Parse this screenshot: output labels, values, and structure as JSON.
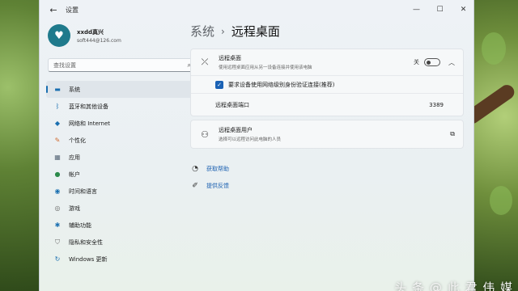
{
  "window": {
    "app_title": "设置",
    "back_icon": "←",
    "controls": [
      "—",
      "☐",
      "✕"
    ]
  },
  "profile": {
    "name": "xxdd真兴",
    "email": "soft444@126.com"
  },
  "search": {
    "placeholder": "查找设置"
  },
  "sidebar": {
    "items": [
      {
        "label": "系统",
        "icon": "display-icon",
        "color": "#1a6fb0",
        "active": true
      },
      {
        "label": "蓝牙和其他设备",
        "icon": "bluetooth-icon",
        "color": "#1a6fb0"
      },
      {
        "label": "网络和 Internet",
        "icon": "wifi-icon",
        "color": "#1a6fb0"
      },
      {
        "label": "个性化",
        "icon": "brush-icon",
        "color": "#d06a2f"
      },
      {
        "label": "应用",
        "icon": "apps-icon",
        "color": "#5a6a7a"
      },
      {
        "label": "帐户",
        "icon": "person-icon",
        "color": "#2b8a4a"
      },
      {
        "label": "时间和语言",
        "icon": "globe-icon",
        "color": "#1a6fb0"
      },
      {
        "label": "游戏",
        "icon": "gamepad-icon",
        "color": "#6a6a6a"
      },
      {
        "label": "辅助功能",
        "icon": "accessibility-icon",
        "color": "#1a6fb0"
      },
      {
        "label": "隐私和安全性",
        "icon": "shield-icon",
        "color": "#6a6a6a"
      },
      {
        "label": "Windows 更新",
        "icon": "update-icon",
        "color": "#1a6fb0"
      }
    ]
  },
  "breadcrumb": {
    "parent": "系统",
    "current": "远程桌面"
  },
  "remote_desktop": {
    "title": "远程桌面",
    "description": "使用远程桌面应用从另一设备连接并使用该电脑",
    "toggle_state": "关",
    "nla_label": "要求设备使用网络级别身份验证连接(推荐)",
    "port_label": "远程桌面端口",
    "port_value": "3389"
  },
  "remote_users": {
    "title": "远程桌面用户",
    "description": "选择可以远程访问此电脑的人员"
  },
  "help": {
    "get_help": "获取帮助",
    "feedback": "提供反馈"
  },
  "watermark": "头 条 @ 此 君 伟 媒"
}
